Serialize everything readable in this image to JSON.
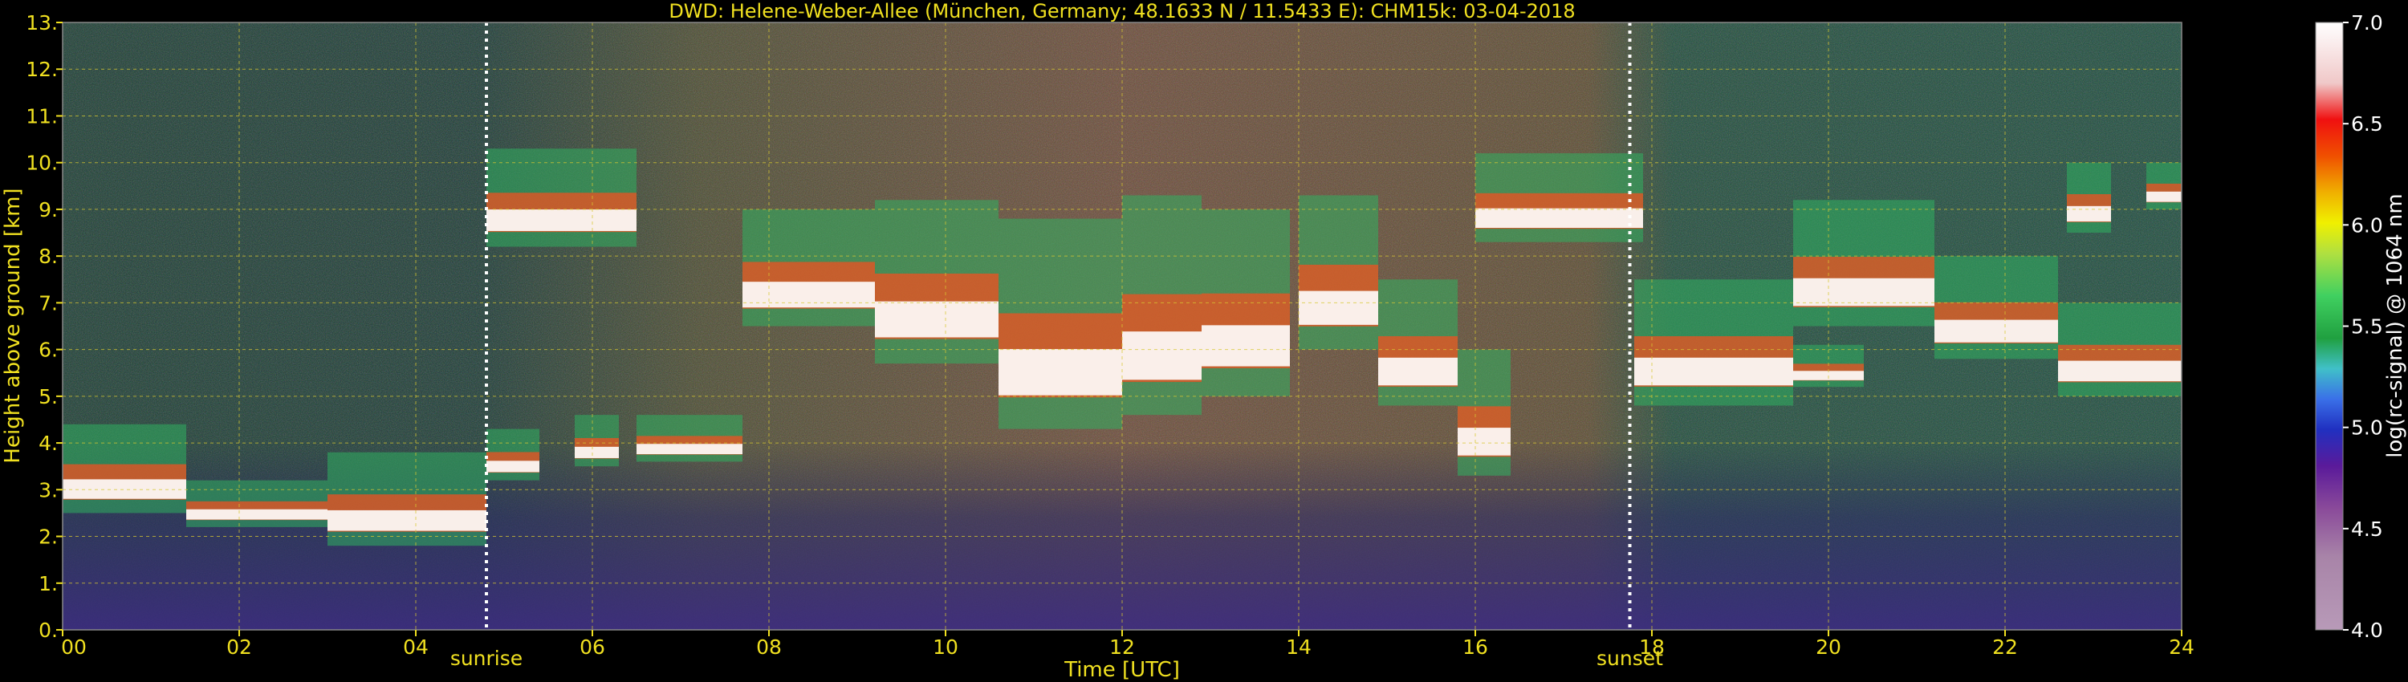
{
  "chart_data": {
    "type": "heatmap",
    "title": "DWD: Helene-Weber-Allee (München, Germany; 48.1633 N / 11.5433 E):    CHM15k: 03-04-2018",
    "xlabel": "Time [UTC]",
    "ylabel": "Height above ground [km]",
    "xlim": [
      0,
      24
    ],
    "ylim": [
      0,
      13
    ],
    "x_ticks": [
      0,
      2,
      4,
      6,
      8,
      10,
      12,
      14,
      16,
      18,
      20,
      22,
      24
    ],
    "x_tick_labels": [
      "00",
      "02",
      "04",
      "06",
      "08",
      "10",
      "12",
      "14",
      "16",
      "18",
      "20",
      "22",
      "24"
    ],
    "y_ticks": [
      0,
      1,
      2,
      3,
      4,
      5,
      6,
      7,
      8,
      9,
      10,
      11,
      12,
      13
    ],
    "y_tick_labels": [
      "0.",
      "1.",
      "2.",
      "3.",
      "4.",
      "5.",
      "6.",
      "7.",
      "8.",
      "9.",
      "10.",
      "11.",
      "12.",
      "13."
    ],
    "grid": true,
    "annotations": [
      {
        "text": "sunrise",
        "time": 4.8
      },
      {
        "text": "sunset",
        "time": 17.75
      }
    ],
    "colorbar": {
      "label": "log(rc-signal) @ 1064 nm",
      "range": [
        4.0,
        7.0
      ],
      "ticks": [
        4.0,
        4.5,
        5.0,
        5.5,
        6.0,
        6.5,
        7.0
      ],
      "tick_labels": [
        "4.0",
        "4.5",
        "5.0",
        "5.5",
        "6.0",
        "6.5",
        "7.0"
      ]
    },
    "cloud_layers": [
      {
        "t0": 0.0,
        "t1": 1.4,
        "base": 2.5,
        "top": 4.4
      },
      {
        "t0": 1.4,
        "t1": 3.0,
        "base": 2.2,
        "top": 3.2
      },
      {
        "t0": 3.0,
        "t1": 4.8,
        "base": 1.8,
        "top": 3.8
      },
      {
        "t0": 4.8,
        "t1": 5.4,
        "base": 3.2,
        "top": 4.3
      },
      {
        "t0": 5.8,
        "t1": 6.3,
        "base": 3.5,
        "top": 4.6
      },
      {
        "t0": 6.5,
        "t1": 7.7,
        "base": 3.6,
        "top": 4.6
      },
      {
        "t0": 4.8,
        "t1": 6.5,
        "base": 8.2,
        "top": 10.3
      },
      {
        "t0": 7.7,
        "t1": 9.2,
        "base": 6.5,
        "top": 9.0
      },
      {
        "t0": 9.2,
        "t1": 10.6,
        "base": 5.7,
        "top": 9.2
      },
      {
        "t0": 10.6,
        "t1": 12.0,
        "base": 4.3,
        "top": 8.8
      },
      {
        "t0": 12.0,
        "t1": 12.9,
        "base": 4.6,
        "top": 9.3
      },
      {
        "t0": 12.9,
        "t1": 13.9,
        "base": 5.0,
        "top": 9.0
      },
      {
        "t0": 14.0,
        "t1": 14.9,
        "base": 6.0,
        "top": 9.3
      },
      {
        "t0": 14.9,
        "t1": 15.8,
        "base": 4.8,
        "top": 7.5
      },
      {
        "t0": 15.8,
        "t1": 16.4,
        "base": 3.3,
        "top": 6.0
      },
      {
        "t0": 16.0,
        "t1": 17.9,
        "base": 8.3,
        "top": 10.2
      },
      {
        "t0": 17.8,
        "t1": 19.6,
        "base": 4.8,
        "top": 7.5
      },
      {
        "t0": 19.6,
        "t1": 20.4,
        "base": 5.2,
        "top": 6.1
      },
      {
        "t0": 19.6,
        "t1": 21.2,
        "base": 6.5,
        "top": 9.2
      },
      {
        "t0": 21.2,
        "t1": 22.6,
        "base": 5.8,
        "top": 8.0
      },
      {
        "t0": 22.6,
        "t1": 24.0,
        "base": 5.0,
        "top": 7.0
      },
      {
        "t0": 22.7,
        "t1": 23.2,
        "base": 8.5,
        "top": 10.0
      },
      {
        "t0": 23.6,
        "t1": 24.0,
        "base": 9.0,
        "top": 10.0
      }
    ]
  }
}
